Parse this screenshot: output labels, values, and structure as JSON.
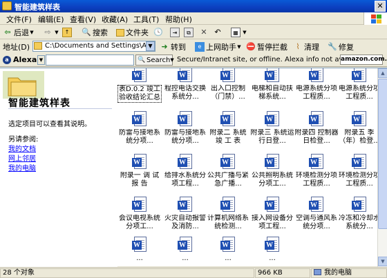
{
  "window": {
    "title": "智能建筑样表"
  },
  "menu": [
    "文件(F)",
    "编辑(E)",
    "查看(V)",
    "收藏(A)",
    "工具(T)",
    "帮助(H)"
  ],
  "toolbar": {
    "back": "后退",
    "search": "搜索",
    "folders": "文件夹"
  },
  "address": {
    "label": "地址(D)",
    "value": "C:\\Documents and Settings\\Administ",
    "go": "转到",
    "internet_helper": "上网助手",
    "pause_block": "暂停拦截",
    "clean": "清理",
    "repair": "修复"
  },
  "alexa": {
    "brand": "Alexa",
    "search_label": "Search",
    "status": "Secure/Intranet site, or offline. Alexa info not available.",
    "amazon": "amazon.com."
  },
  "leftpane": {
    "title": "智能建筑样表",
    "description": "选定项目可以查看其说明。",
    "see_also": "另请参阅:",
    "links": [
      "我的文档",
      "网上邻居",
      "我的电脑"
    ]
  },
  "files": [
    "表D.0.2 竣工验收结论汇总",
    "程控电话交换系统分...",
    "出入口控制（门禁）...",
    "电梯和自动扶梯系统...",
    "电源系统分项工程质...",
    "电源系统分项工程质...",
    "防雷与接地系统分项...",
    "防雷与接地系统分项...",
    "附录二 系统 竣 工 表",
    "附录三 系统运行日登...",
    "附录四 控制器日检登...",
    "附录五 季（年）检登...",
    "附录一 调 试 报 告",
    "给排水系统分项工程...",
    "公共广播与紧急广播...",
    "公共照明系统分项工...",
    "环境检测分项工程质...",
    "环境检测分项工程质...",
    "会议电视系统分项工...",
    "火灾自动报警及消防...",
    "计算机网络系统检测...",
    "接入网设备分项工程...",
    "空调与通风系统分项...",
    "冷冻和冷却水系统分...",
    "...",
    "...",
    "...",
    "..."
  ],
  "status": {
    "count": "28 个对象",
    "size": "966 KB",
    "location": "我的电脑"
  }
}
